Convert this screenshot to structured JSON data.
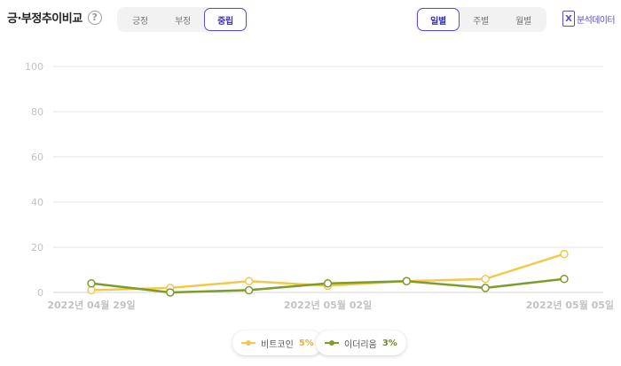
{
  "header": {
    "title": "긍·부정추이비교",
    "help_symbol": "?"
  },
  "sentiment_tabs": {
    "options": [
      "긍정",
      "부정",
      "중립"
    ],
    "selected": "중립"
  },
  "period_tabs": {
    "options": [
      "일별",
      "주별",
      "월별"
    ],
    "selected": "일별"
  },
  "analysis_button": {
    "label": "분석데이터",
    "icon": "excel-icon"
  },
  "colors": {
    "accent": "#5a4bd4",
    "btc": "#f1c94e",
    "eth": "#7f9b2c",
    "grid": "#e6e6e6",
    "axis_text": "#c2c2c2"
  },
  "chart_data": {
    "type": "line",
    "x": [
      "2022-04-29",
      "2022-04-30",
      "2022-05-01",
      "2022-05-02",
      "2022-05-03",
      "2022-05-04",
      "2022-05-05"
    ],
    "x_tick_labels": [
      "2022년 04월 29일",
      "",
      "",
      "2022년 05월 02일",
      "",
      "",
      "2022년 05월 05일"
    ],
    "ylim": [
      0,
      100
    ],
    "y_ticks": [
      0,
      20,
      40,
      60,
      80,
      100
    ],
    "grid": true,
    "legend_position": "bottom-center",
    "series": [
      {
        "name": "비트코인",
        "value_label": "5%",
        "color": "#f1c94e",
        "values": [
          1,
          2,
          5,
          3,
          5,
          6,
          17
        ]
      },
      {
        "name": "이더리움",
        "value_label": "3%",
        "color": "#7f9b2c",
        "values": [
          4,
          0,
          1,
          4,
          5,
          2,
          6
        ]
      }
    ]
  }
}
